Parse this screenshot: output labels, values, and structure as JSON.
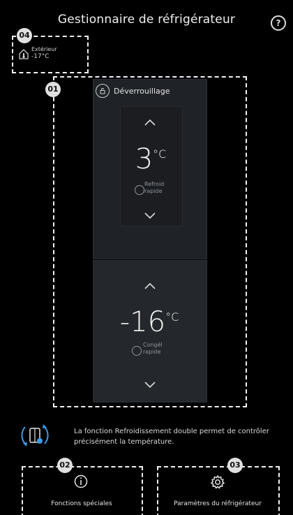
{
  "header": {
    "title": "Gestionnaire de réfrigérateur",
    "help_glyph": "?"
  },
  "callouts": {
    "c01": "01",
    "c02": "02",
    "c03": "03",
    "c04": "04"
  },
  "exterior": {
    "label": "Extérieur",
    "value": "-17°C",
    "icon": "home-thermometer-icon"
  },
  "unlock": {
    "label": "Déverrouillage",
    "icon": "unlock-icon"
  },
  "fridge": {
    "temperature": "3",
    "unit": "°C",
    "mode_line1": "Refroid",
    "mode_line2": "rapide"
  },
  "freezer": {
    "temperature": "-16",
    "unit": "°C",
    "mode_line1": "Congél",
    "mode_line2": "rapide"
  },
  "info": {
    "text": "La fonction Refroidissement double permet de contrôler précisément la température.",
    "icon": "twin-cooling-icon"
  },
  "buttons": {
    "special": {
      "label": "Fonctions spéciales",
      "icon": "info-icon"
    },
    "settings": {
      "label": "Paramètres du réfrigérateur",
      "icon": "gear-icon"
    }
  },
  "colors": {
    "background": "#000000",
    "panel": "#1f2226",
    "accent": "#3d9be9"
  }
}
